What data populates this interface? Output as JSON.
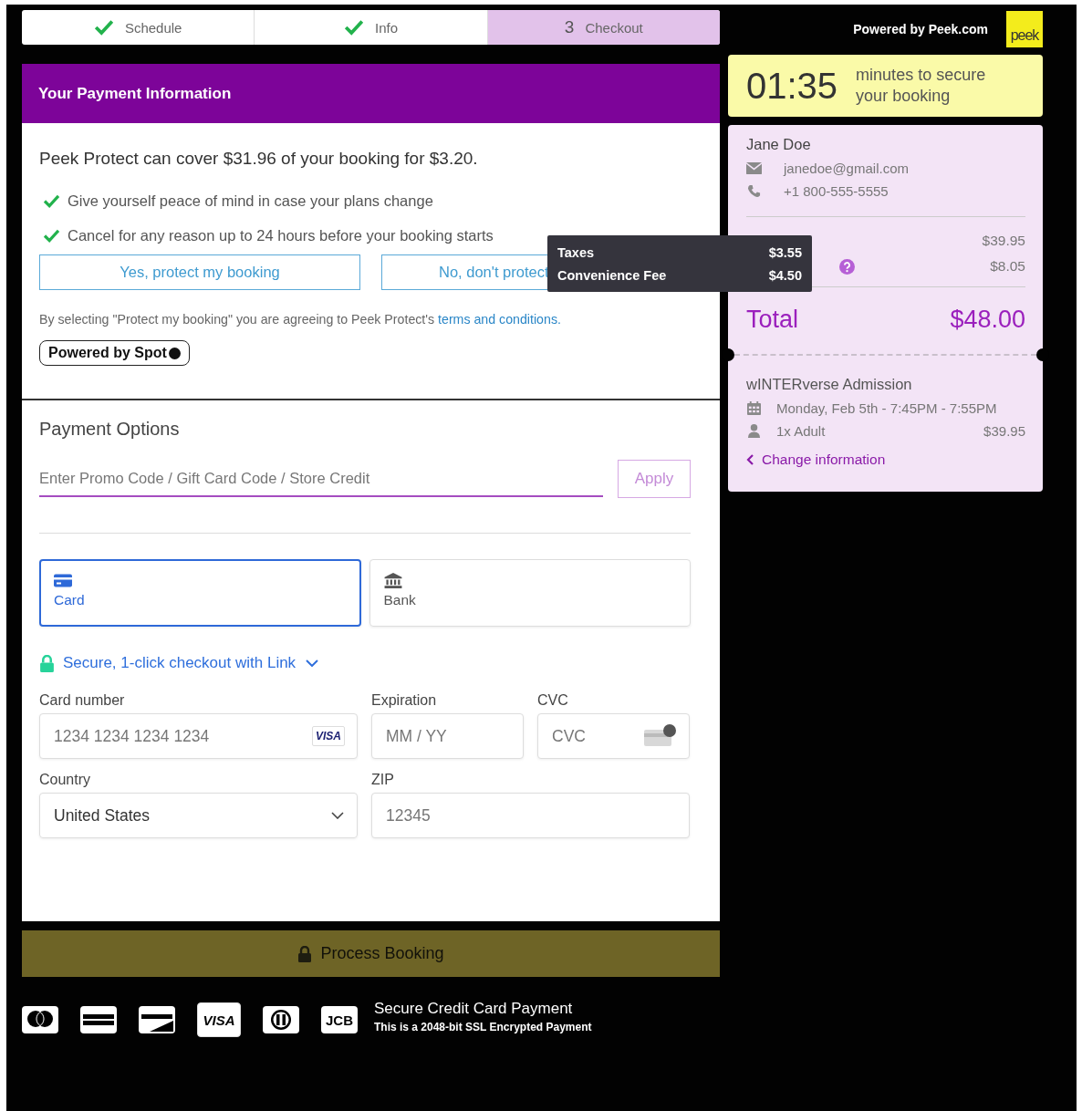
{
  "steps": [
    {
      "label": "Schedule",
      "done": true,
      "selected": false
    },
    {
      "label": "Info",
      "done": true,
      "selected": false
    },
    {
      "label": "Checkout",
      "done": false,
      "number": "3",
      "selected": true
    }
  ],
  "powered_by": "Powered by Peek.com",
  "logo": "peek",
  "payment_header": "Your Payment Information",
  "protect": {
    "headline": "Peek Protect can cover $31.96 of your booking for $3.20.",
    "benefits": [
      "Give yourself peace of mind in case your plans change",
      "Cancel for any reason up to 24 hours before your booking starts"
    ],
    "buttons": [
      "Yes, protect my booking",
      "No, don't protect"
    ],
    "terms": "By selecting \"Protect my booking\" you are agreeing to Peek Protect's ",
    "terms_link": "terms and conditions.",
    "badge": "Powered by Spot"
  },
  "payment_options": {
    "title": "Payment Options",
    "promo": {
      "placeholder": "Enter Promo Code / Gift Card Code / Store Credit"
    },
    "apply": "Apply",
    "methods": [
      {
        "kind": "card",
        "label": "Card",
        "selected": true
      },
      {
        "kind": "bank",
        "label": "Bank",
        "selected": false
      }
    ],
    "link": "Secure, 1-click checkout with Link",
    "fields": [
      {
        "kind": "card",
        "label": "Card number",
        "placeholder": "1234 1234 1234 1234",
        "badge": "VISA"
      },
      {
        "kind": "plain",
        "label": "Expiration",
        "placeholder": "MM / YY"
      },
      {
        "kind": "cvc",
        "label": "CVC",
        "placeholder": "CVC"
      },
      {
        "kind": "select",
        "label": "Country",
        "value": "United States"
      },
      {
        "kind": "plain",
        "label": "ZIP",
        "placeholder": "12345"
      }
    ]
  },
  "process_button": "Process Booking",
  "card_brands": [
    {
      "kind": "mastercard"
    },
    {
      "kind": "amex"
    },
    {
      "kind": "discover"
    },
    {
      "kind": "visa",
      "label": "VISA"
    },
    {
      "kind": "diners"
    },
    {
      "kind": "jcb",
      "label": "JCB"
    }
  ],
  "secure": {
    "title": "Secure Credit Card Payment",
    "subtitle": "This is a 2048-bit SSL Encrypted Payment"
  },
  "timer": {
    "time": "01:35",
    "text": "minutes to secure your booking"
  },
  "summary": {
    "name": "Jane Doe",
    "email": "janedoe@gmail.com",
    "phone": "+1 800-555-5555",
    "lines": [
      {
        "value": "$39.95",
        "help": false
      },
      {
        "value": "$8.05",
        "help": true
      }
    ],
    "total_label": "Total",
    "total": "$48.00",
    "event": "wINTERverse Admission",
    "date": "Monday, Feb 5th - 7:45PM - 7:55PM",
    "ticket": "1x Adult",
    "ticket_price": "$39.95",
    "change": "Change information"
  },
  "tooltip": [
    {
      "label": "Taxes",
      "value": "$3.55"
    },
    {
      "label": "Convenience Fee",
      "value": "$4.50"
    }
  ]
}
